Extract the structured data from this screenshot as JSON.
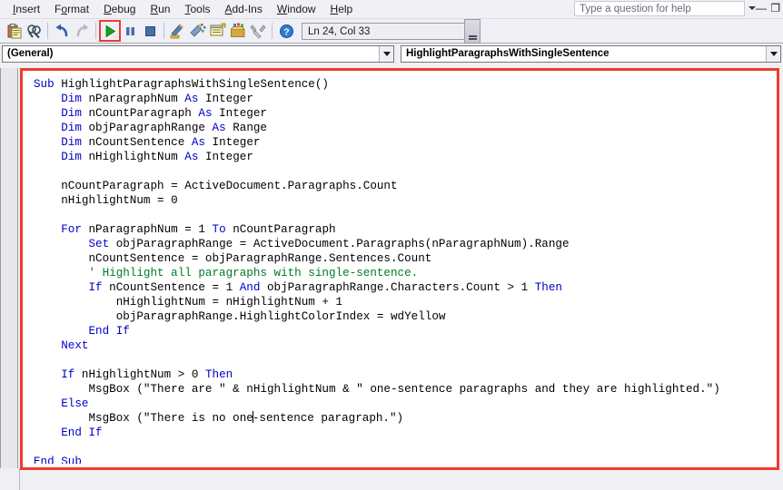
{
  "window": {
    "help_placeholder": "Type a question for help",
    "minimize_label": "—",
    "restore_label": "❐"
  },
  "menubar": {
    "items": [
      {
        "label": "Insert",
        "accel": "I"
      },
      {
        "label": "Format",
        "accel": "o"
      },
      {
        "label": "Debug",
        "accel": "D"
      },
      {
        "label": "Run",
        "accel": "R"
      },
      {
        "label": "Tools",
        "accel": "T"
      },
      {
        "label": "Add-Ins",
        "accel": "A"
      },
      {
        "label": "Window",
        "accel": "W"
      },
      {
        "label": "Help",
        "accel": "H"
      }
    ]
  },
  "toolbar": {
    "buttons": [
      {
        "name": "paste-icon",
        "title": "Paste"
      },
      {
        "name": "find-icon",
        "title": "Find"
      },
      {
        "name": "undo-icon",
        "title": "Undo"
      },
      {
        "name": "redo-icon",
        "title": "Redo"
      },
      {
        "name": "run-icon",
        "title": "Run Sub/UserForm",
        "highlighted": true
      },
      {
        "name": "pause-icon",
        "title": "Break"
      },
      {
        "name": "stop-icon",
        "title": "Reset"
      },
      {
        "name": "design-mode-icon",
        "title": "Design Mode"
      },
      {
        "name": "project-explorer-icon",
        "title": "Project Explorer"
      },
      {
        "name": "properties-window-icon",
        "title": "Properties Window"
      },
      {
        "name": "object-browser-icon",
        "title": "Object Browser"
      },
      {
        "name": "toolbox-icon",
        "title": "Toolbox"
      },
      {
        "name": "help-icon",
        "title": "Microsoft Visual Basic Help"
      }
    ],
    "status_text": "Ln 24, Col 33",
    "run_highlight_color": "#ee3b2f"
  },
  "combos": {
    "object": "(General)",
    "procedure": "HighlightParagraphsWithSingleSentence"
  },
  "code": {
    "highlight_border_color": "#ee3b2f",
    "lines": [
      [
        {
          "t": "Sub ",
          "c": "kw"
        },
        {
          "t": "HighlightParagraphsWithSingleSentence()",
          "c": "pl"
        }
      ],
      [
        {
          "t": "    ",
          "c": "pl"
        },
        {
          "t": "Dim ",
          "c": "kw"
        },
        {
          "t": "nParagraphNum ",
          "c": "pl"
        },
        {
          "t": "As ",
          "c": "kw"
        },
        {
          "t": "Integer",
          "c": "pl"
        }
      ],
      [
        {
          "t": "    ",
          "c": "pl"
        },
        {
          "t": "Dim ",
          "c": "kw"
        },
        {
          "t": "nCountParagraph ",
          "c": "pl"
        },
        {
          "t": "As ",
          "c": "kw"
        },
        {
          "t": "Integer",
          "c": "pl"
        }
      ],
      [
        {
          "t": "    ",
          "c": "pl"
        },
        {
          "t": "Dim ",
          "c": "kw"
        },
        {
          "t": "objParagraphRange ",
          "c": "pl"
        },
        {
          "t": "As ",
          "c": "kw"
        },
        {
          "t": "Range",
          "c": "pl"
        }
      ],
      [
        {
          "t": "    ",
          "c": "pl"
        },
        {
          "t": "Dim ",
          "c": "kw"
        },
        {
          "t": "nCountSentence ",
          "c": "pl"
        },
        {
          "t": "As ",
          "c": "kw"
        },
        {
          "t": "Integer",
          "c": "pl"
        }
      ],
      [
        {
          "t": "    ",
          "c": "pl"
        },
        {
          "t": "Dim ",
          "c": "kw"
        },
        {
          "t": "nHighlightNum ",
          "c": "pl"
        },
        {
          "t": "As ",
          "c": "kw"
        },
        {
          "t": "Integer",
          "c": "pl"
        }
      ],
      [],
      [
        {
          "t": "    nCountParagraph = ActiveDocument.Paragraphs.Count",
          "c": "pl"
        }
      ],
      [
        {
          "t": "    nHighlightNum = 0",
          "c": "pl"
        }
      ],
      [],
      [
        {
          "t": "    ",
          "c": "pl"
        },
        {
          "t": "For ",
          "c": "kw"
        },
        {
          "t": "nParagraphNum = 1 ",
          "c": "pl"
        },
        {
          "t": "To ",
          "c": "kw"
        },
        {
          "t": "nCountParagraph",
          "c": "pl"
        }
      ],
      [
        {
          "t": "        ",
          "c": "pl"
        },
        {
          "t": "Set ",
          "c": "kw"
        },
        {
          "t": "objParagraphRange = ActiveDocument.Paragraphs(nParagraphNum).Range",
          "c": "pl"
        }
      ],
      [
        {
          "t": "        nCountSentence = objParagraphRange.Sentences.Count",
          "c": "pl"
        }
      ],
      [
        {
          "t": "        ' Highlight all paragraphs with single-sentence.",
          "c": "cm"
        }
      ],
      [
        {
          "t": "        ",
          "c": "pl"
        },
        {
          "t": "If ",
          "c": "kw"
        },
        {
          "t": "nCountSentence = 1 ",
          "c": "pl"
        },
        {
          "t": "And ",
          "c": "kw"
        },
        {
          "t": "objParagraphRange.Characters.Count > 1 ",
          "c": "pl"
        },
        {
          "t": "Then",
          "c": "kw"
        }
      ],
      [
        {
          "t": "            nHighlightNum = nHighlightNum + 1",
          "c": "pl"
        }
      ],
      [
        {
          "t": "            objParagraphRange.HighlightColorIndex = wdYellow",
          "c": "pl"
        }
      ],
      [
        {
          "t": "        ",
          "c": "pl"
        },
        {
          "t": "End If",
          "c": "kw"
        }
      ],
      [
        {
          "t": "    ",
          "c": "pl"
        },
        {
          "t": "Next",
          "c": "kw"
        }
      ],
      [],
      [
        {
          "t": "    ",
          "c": "pl"
        },
        {
          "t": "If ",
          "c": "kw"
        },
        {
          "t": "nHighlightNum > 0 ",
          "c": "pl"
        },
        {
          "t": "Then",
          "c": "kw"
        }
      ],
      [
        {
          "t": "        MsgBox (\"There are \" & nHighlightNum & \" one-sentence paragraphs and they are highlighted.\")",
          "c": "pl"
        }
      ],
      [
        {
          "t": "    ",
          "c": "pl"
        },
        {
          "t": "Else",
          "c": "kw"
        }
      ],
      [
        {
          "t": "        MsgBox (\"There is no one",
          "c": "pl"
        },
        {
          "t": "|CARET|",
          "c": "caret"
        },
        {
          "t": "-sentence paragraph.\")",
          "c": "pl"
        }
      ],
      [
        {
          "t": "    ",
          "c": "pl"
        },
        {
          "t": "End If",
          "c": "kw"
        }
      ],
      [],
      [
        {
          "t": "End Sub",
          "c": "kw"
        }
      ]
    ]
  }
}
